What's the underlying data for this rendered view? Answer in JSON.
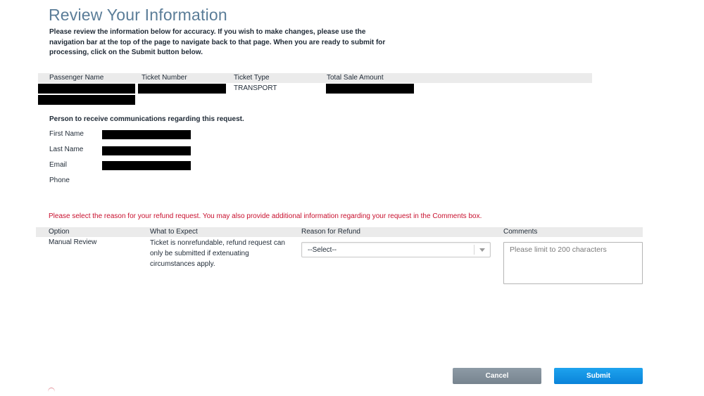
{
  "page": {
    "title": "Review Your Information",
    "intro": "Please review the information below for accuracy. If you wish to make changes, please use the navigation bar at the top of the page to navigate back to that page. When you are ready to submit for processing, click on the Submit button below."
  },
  "ticket_table": {
    "headers": [
      "Passenger Name",
      "Ticket Number",
      "Ticket Type",
      "Total Sale Amount"
    ],
    "row": {
      "passenger_name": "[REDACTED]",
      "ticket_number": "[REDACTED]",
      "ticket_type": "TRANSPORT",
      "total_sale_amount": "[REDACTED]"
    }
  },
  "contact": {
    "heading": "Person to receive communications regarding this request.",
    "fields": [
      {
        "label": "First Name",
        "value": "[REDACTED]"
      },
      {
        "label": "Last Name",
        "value": "[REDACTED]"
      },
      {
        "label": "Email",
        "value": "[REDACTED]"
      },
      {
        "label": "Phone",
        "value": ""
      }
    ]
  },
  "refund": {
    "notice": "Please select the reason for your refund request. You may also provide additional information regarding your request in the Comments box.",
    "headers": [
      "Option",
      "What to Expect",
      "Reason for Refund",
      "Comments"
    ],
    "row": {
      "option": "Manual Review",
      "what_to_expect": "Ticket is nonrefundable, refund request can only be submitted if extenuating circumstances apply.",
      "reason_selected": "--Select--",
      "comments_placeholder": "Please limit to 200 characters"
    }
  },
  "buttons": {
    "cancel": "Cancel",
    "submit": "Submit"
  },
  "colors": {
    "title": "#5b7d98",
    "notice_red": "#c8102e",
    "header_band": "#ebebeb",
    "cancel_button": "#7f8c97",
    "submit_button": "#1592e3"
  },
  "icons": {
    "warning": "warning-circle-icon",
    "select_arrow": "chevron-down-icon"
  }
}
